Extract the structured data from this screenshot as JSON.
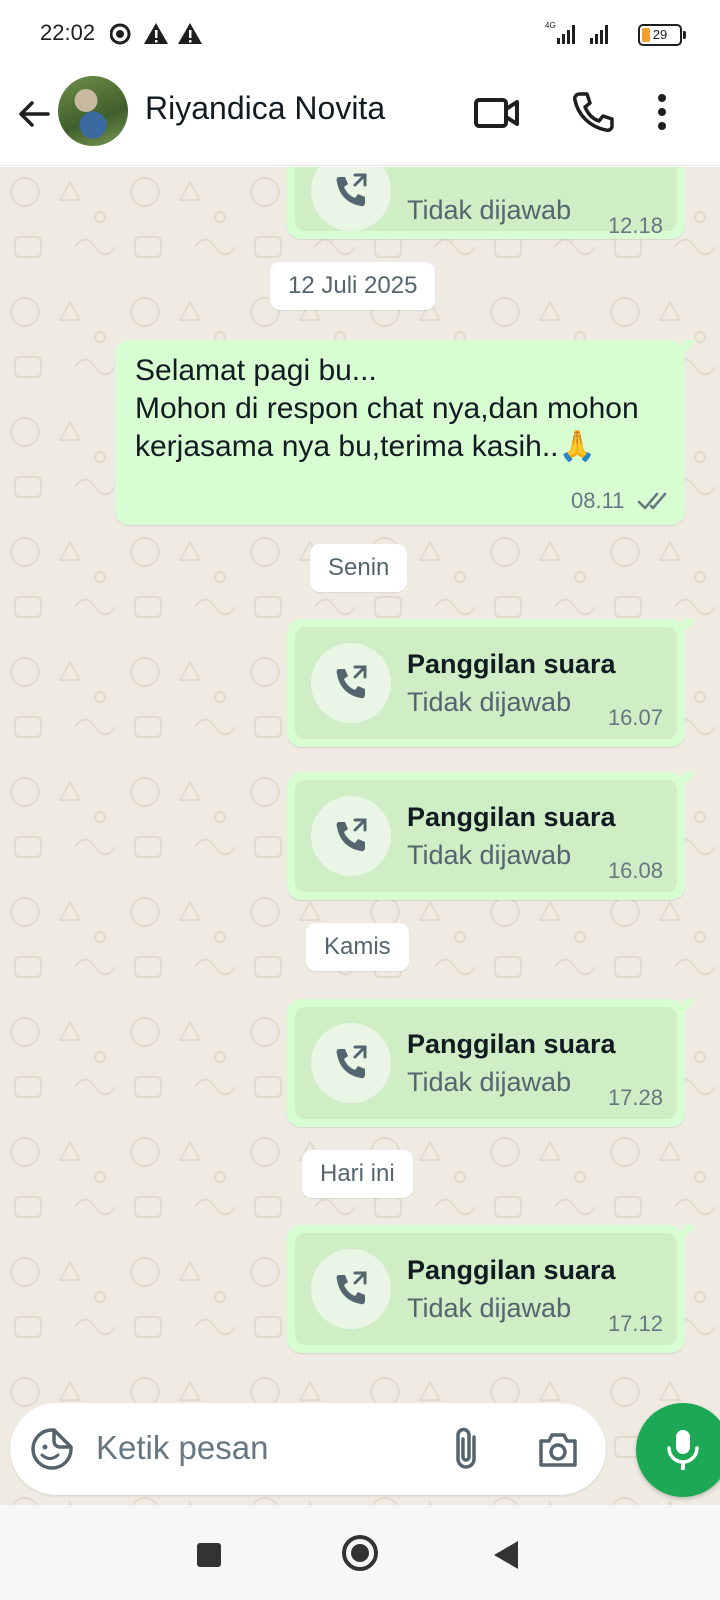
{
  "status_bar": {
    "time": "22:02",
    "network": "4G",
    "battery": "29",
    "icons": [
      "data-saver-icon",
      "warning-icon",
      "warning-icon",
      "signal-icon",
      "signal-icon",
      "battery-icon"
    ]
  },
  "header": {
    "contact_name": "Riyandica Novita",
    "icons": [
      "back-arrow-icon",
      "avatar",
      "video-call-icon",
      "phone-icon",
      "more-options-icon"
    ]
  },
  "chat": {
    "partial_call": {
      "status": "Tidak dijawab",
      "time": "12.18"
    },
    "date_1": "12 Juli 2025",
    "text_message": {
      "text": "Selamat pagi bu...\nMohon di respon chat nya,dan mohon kerjasama nya bu,terima kasih..🙏",
      "time": "08.11",
      "status_icon": "double-check-icon"
    },
    "date_2": "Senin",
    "call_1": {
      "title": "Panggilan suara",
      "status": "Tidak dijawab",
      "time": "16.07"
    },
    "call_2": {
      "title": "Panggilan suara",
      "status": "Tidak dijawab",
      "time": "16.08"
    },
    "date_3": "Kamis",
    "call_3": {
      "title": "Panggilan suara",
      "status": "Tidak dijawab",
      "time": "17.28"
    },
    "date_4": "Hari ini",
    "call_4": {
      "title": "Panggilan suara",
      "status": "Tidak dijawab",
      "time": "17.12"
    }
  },
  "composer": {
    "placeholder": "Ketik pesan",
    "icons": [
      "sticker-icon",
      "attach-icon",
      "camera-icon",
      "mic-icon"
    ]
  },
  "colors": {
    "outgoing_bubble": "#d9fdd3",
    "call_inner": "#cfeec6",
    "chat_background": "#efeae2",
    "accent_green": "#1da856"
  }
}
